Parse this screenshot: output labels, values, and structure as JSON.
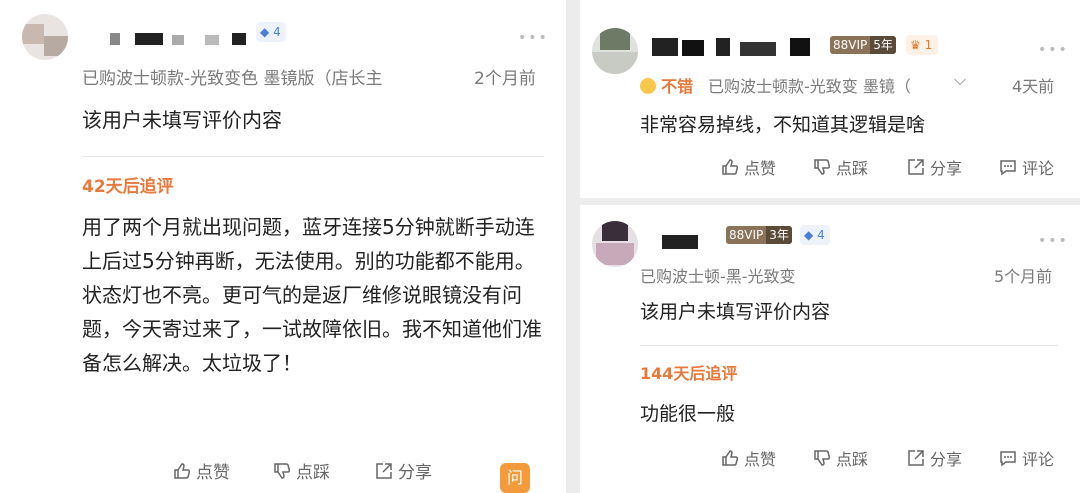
{
  "left_card": {
    "level_count": "4",
    "purchase_info": "已购波士顿款-光致变色 墨镜版（店长主",
    "time": "2个月前",
    "content": "该用户未填写评价内容",
    "followup_label": "42天后追评",
    "followup_text": "用了两个月就出现问题，蓝牙连接5分钟就断手动连上后过5分钟再断，无法使用。别的功能都不能用。状态灯也不亮。更可气的是返厂维修说眼镜没有问题，今天寄过来了，一试故障依旧。我不知道他们准备怎么解决。太垃圾了！",
    "actions": [
      "点赞",
      "点踩",
      "分享"
    ],
    "chat_button": "问"
  },
  "right_card_1": {
    "vip_label": "88VIP",
    "vip_years": "5年",
    "crown_count": "1",
    "rating": "不错",
    "purchase_info": "已购波士顿款-光致变 墨镜（",
    "time": "4天前",
    "content": "非常容易掉线，不知道其逻辑是啥",
    "actions": [
      "点赞",
      "点踩",
      "分享",
      "评论"
    ]
  },
  "right_card_2": {
    "vip_label": "88VIP",
    "vip_years": "3年",
    "level_count": "4",
    "purchase_info": "已购波士顿-黑-光致变",
    "time": "5个月前",
    "content": "该用户未填写评价内容",
    "followup_label": "144天后追评",
    "followup_text": "功能很一般",
    "actions": [
      "点赞",
      "点踩",
      "分享",
      "评论"
    ]
  },
  "icons": [
    "thumbs-up-icon",
    "thumbs-down-icon",
    "share-icon",
    "comment-icon",
    "diamond-icon",
    "crown-icon",
    "chevron-down-icon",
    "more-icon",
    "smile-icon"
  ],
  "colors": {
    "accent": "#e8793a",
    "level_blue": "#4a7fd6",
    "vip": "#8a7358"
  }
}
